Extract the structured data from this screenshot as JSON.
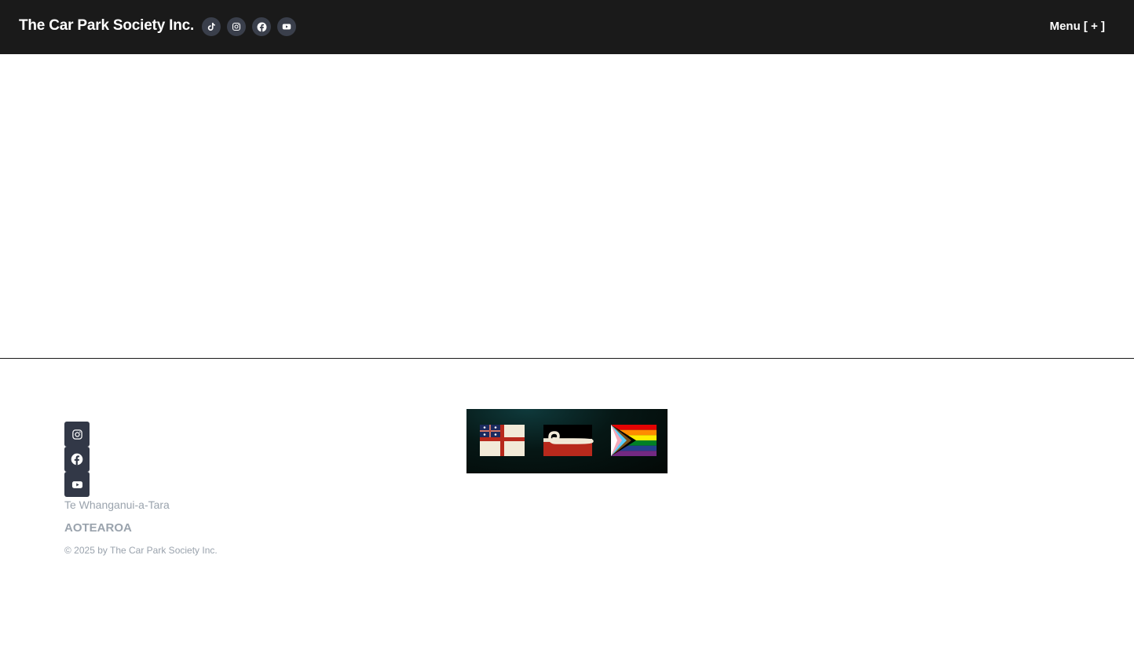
{
  "header": {
    "brand": "The Car Park Society Inc.",
    "menu_label": "Menu [ + ]",
    "social_icons": [
      "tiktok-icon",
      "instagram-icon",
      "facebook-icon",
      "youtube-icon"
    ]
  },
  "footer": {
    "social_icons": [
      "instagram-icon",
      "facebook-icon",
      "youtube-icon"
    ],
    "place": "Te Whanganui-a-Tara",
    "country": "AOTEAROA",
    "copyright": "© 2025 by The Car Park Society Inc.",
    "flags": [
      "united-tribes-flag",
      "tino-rangatiratanga-flag",
      "progress-pride-flag"
    ]
  },
  "colors": {
    "header_bg": "#1a1a1a",
    "icon_bg": "#3a3f4b",
    "footer_icon_bg": "#323847",
    "footer_text": "#9aa3ad"
  }
}
